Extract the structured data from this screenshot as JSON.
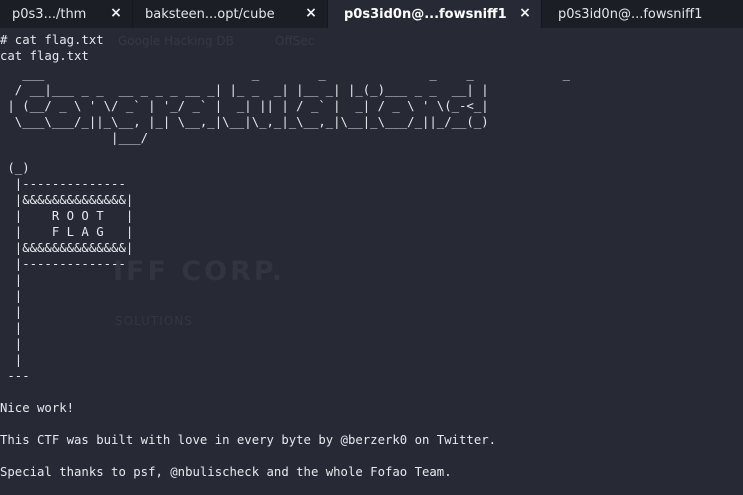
{
  "tabs": [
    {
      "label": "p0s3.../thm",
      "active": false
    },
    {
      "label": "baksteen...opt/cube",
      "active": false
    },
    {
      "label": "p0s3id0n@...fowsniff1",
      "active": true
    },
    {
      "label": "p0s3id0n@...fowsniff1",
      "active": false
    }
  ],
  "tab_close_icon": "×",
  "watermark": {
    "google": "Google Hacking DB",
    "offsec": "OffSec",
    "corp": "IFF CORP.",
    "solutions": "SOLUTIONS"
  },
  "terminal": {
    "command": "# cat flag.txt",
    "echo": "cat flag.txt",
    "banner_ascii": "   ___                            _        _              _    _            _\n  / __|___ _ _  __ _ _ _ __ _| |_ _  _| |__ _| |_(_)___ _ _  __| |\n | (__/ _ \\ ' \\/ _` | '_/ _` |  _| || | / _` |  _| / _ \\ ' \\(_-<_|\n  \\___\\___/_||_\\__, |_| \\__,_|\\__|\\_,_|_\\__,_|\\__|_\\___/_||_/__(_)\n               |___/",
    "flag_ascii": " (_)\n  |--------------\n  |&&&&&&&&&&&&&&|\n  |    R O O T   |\n  |    F L A G   |\n  |&&&&&&&&&&&&&&|\n  |--------------\n  |\n  |\n  |\n  |\n  |\n  |\n ---",
    "nice_work": "Nice work!",
    "credits": "This CTF was built with love in every byte by @berzerk0 on Twitter.",
    "thanks": "Special thanks to psf, @nbulischeck and the whole Fofao Team."
  },
  "colors": {
    "terminal_bg": "#272a34",
    "tabbar_bg": "#1c1e25",
    "text": "#e6e8ec"
  }
}
